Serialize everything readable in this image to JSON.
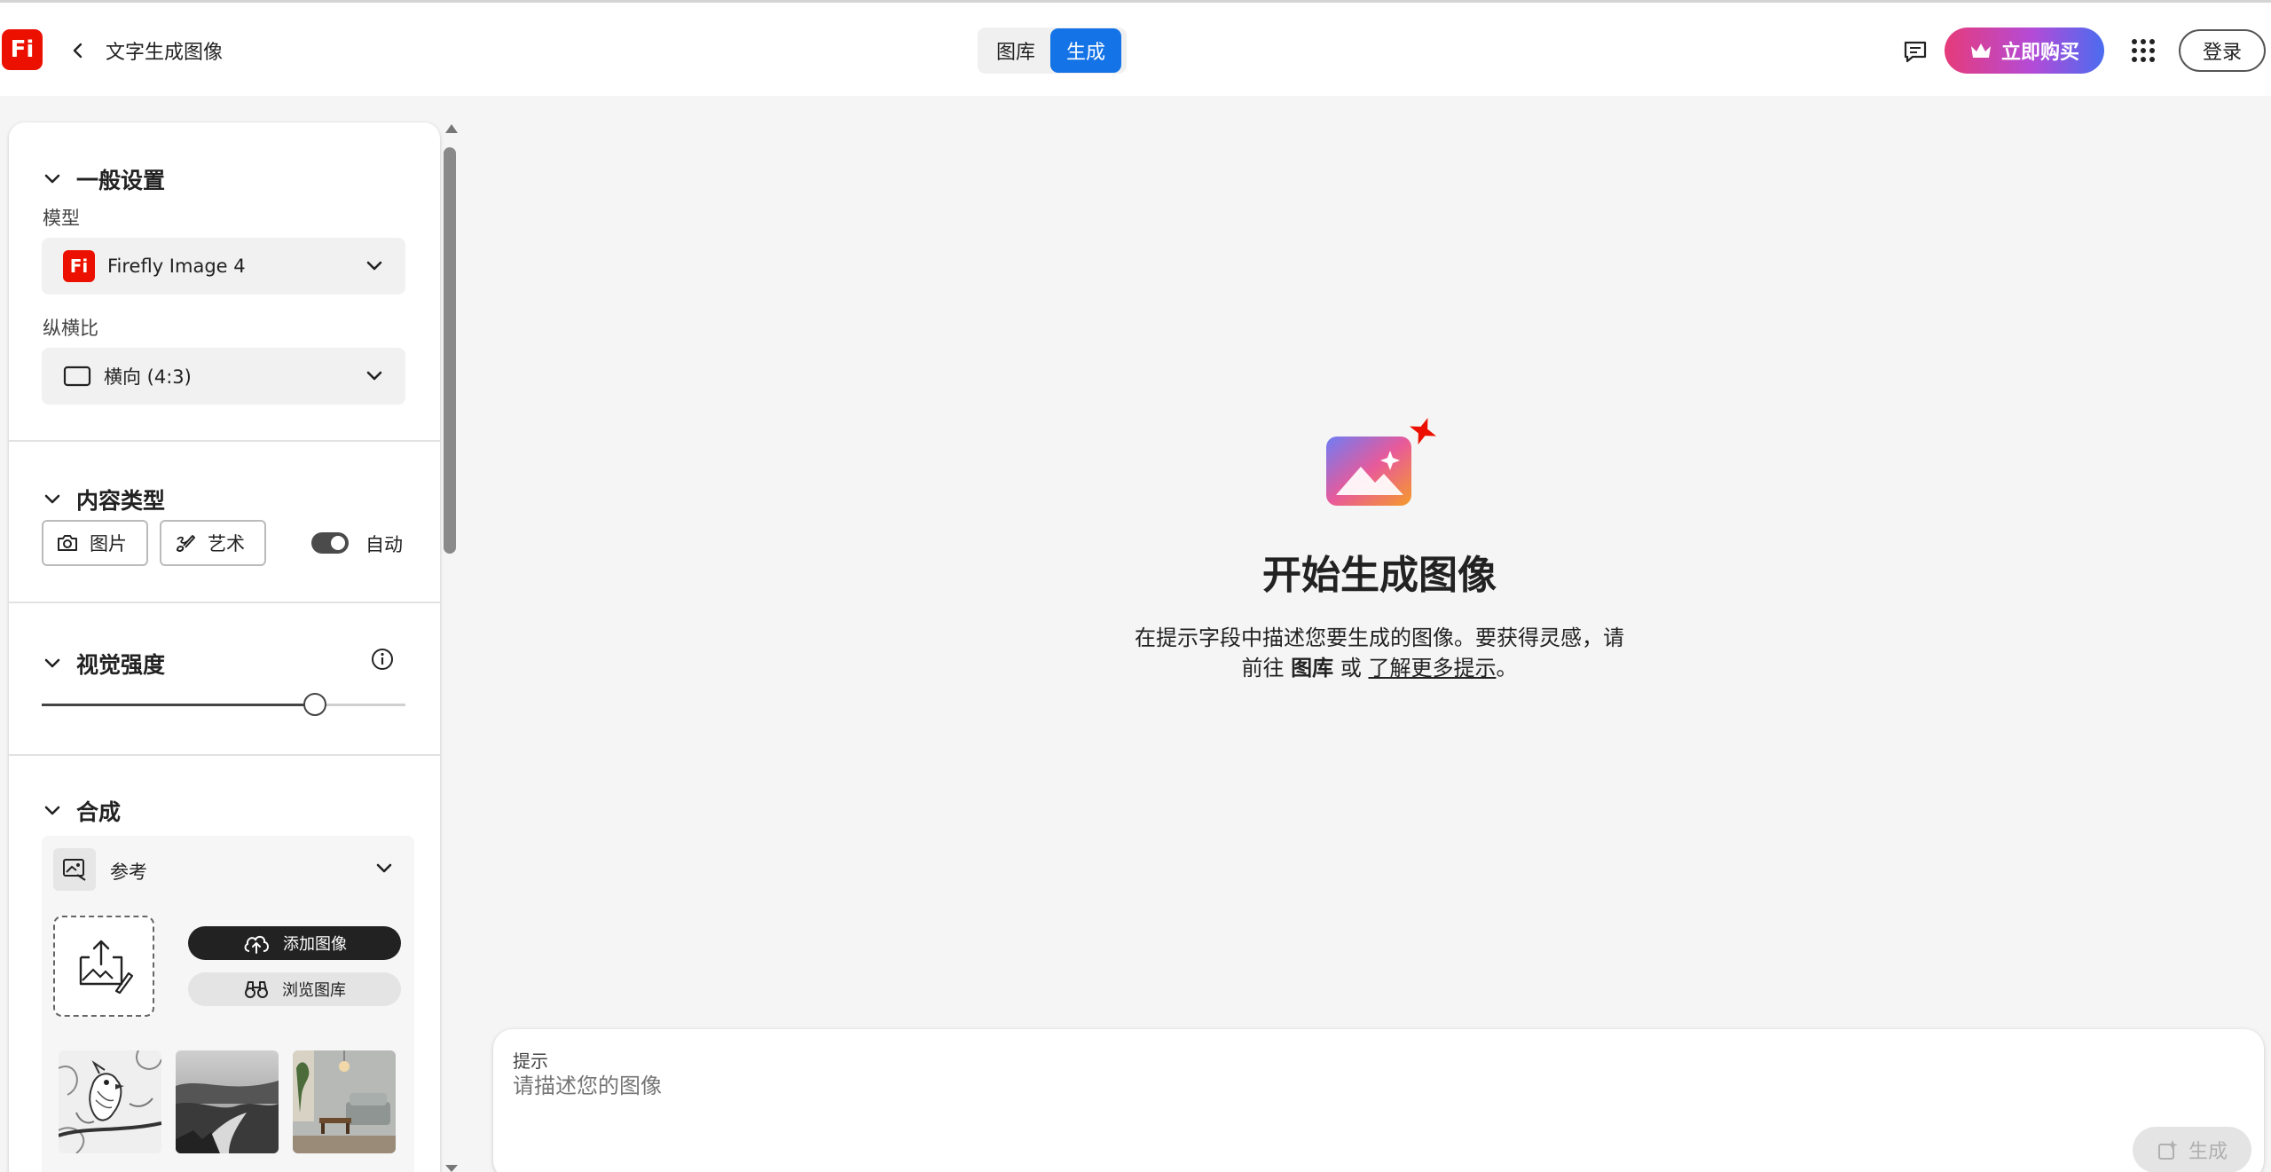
{
  "topbar": {
    "logo_text": "Fi",
    "title": "文字生成图像",
    "tabs": [
      {
        "label": "图库",
        "active": false
      },
      {
        "label": "生成",
        "active": true
      }
    ],
    "buy_label": "立即购买",
    "login_label": "登录"
  },
  "panel": {
    "general": {
      "title": "一般设置",
      "model_label": "模型",
      "model_value": "Firefly Image 4",
      "aspect_label": "纵横比",
      "aspect_value": "横向 (4:3)"
    },
    "content_type": {
      "title": "内容类型",
      "photo_label": "图片",
      "art_label": "艺术",
      "auto_label": "自动",
      "auto_on": true
    },
    "visual_intensity": {
      "title": "视觉强度",
      "level": 0.75
    },
    "composition": {
      "title": "合成",
      "reference_label": "参考",
      "add_image_label": "添加图像",
      "browse_label": "浏览图库"
    }
  },
  "empty_state": {
    "title": "开始生成图像",
    "desc_line1": "在提示字段中描述您要生成的图像。要获得灵感，请",
    "desc_prefix": "前往",
    "desc_gallery": "图库",
    "desc_or": "或",
    "desc_link": "了解更多提示",
    "desc_end": "。"
  },
  "prompt": {
    "label": "提示",
    "placeholder": "请描述您的图像",
    "generate_label": "生成"
  },
  "colors": {
    "accent": "#1473e6",
    "brand": "#eb1000"
  }
}
